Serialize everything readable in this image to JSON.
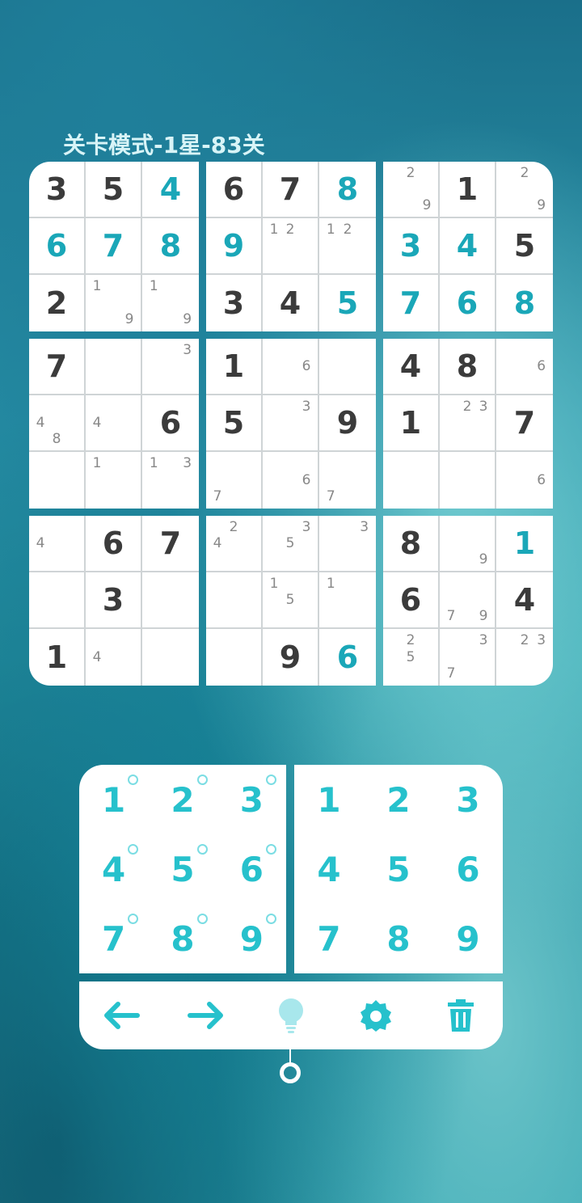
{
  "header": {
    "title": "关卡模式-1星-83关"
  },
  "colors": {
    "given": "#3b3b3b",
    "user": "#1aa7b8",
    "accent": "#26c1cc"
  },
  "board": {
    "rows": [
      [
        {
          "v": "3",
          "t": "given"
        },
        {
          "v": "5",
          "t": "given"
        },
        {
          "v": "4",
          "t": "user"
        },
        {
          "v": "6",
          "t": "given"
        },
        {
          "v": "7",
          "t": "given"
        },
        {
          "v": "8",
          "t": "user"
        },
        {
          "n": [
            "2",
            "9"
          ]
        },
        {
          "v": "1",
          "t": "given"
        },
        {
          "n": [
            "2",
            "9"
          ]
        }
      ],
      [
        {
          "v": "6",
          "t": "user"
        },
        {
          "v": "7",
          "t": "user"
        },
        {
          "v": "8",
          "t": "user"
        },
        {
          "v": "9",
          "t": "user"
        },
        {
          "n": [
            "1",
            "2"
          ]
        },
        {
          "n": [
            "1",
            "2"
          ]
        },
        {
          "v": "3",
          "t": "user"
        },
        {
          "v": "4",
          "t": "user"
        },
        {
          "v": "5",
          "t": "given"
        }
      ],
      [
        {
          "v": "2",
          "t": "given"
        },
        {
          "n": [
            "1",
            "9"
          ]
        },
        {
          "n": [
            "1",
            "9"
          ]
        },
        {
          "v": "3",
          "t": "given"
        },
        {
          "v": "4",
          "t": "given"
        },
        {
          "v": "5",
          "t": "user"
        },
        {
          "v": "7",
          "t": "user"
        },
        {
          "v": "6",
          "t": "user"
        },
        {
          "v": "8",
          "t": "user"
        }
      ],
      [
        {
          "v": "7",
          "t": "given"
        },
        {},
        {
          "n": [
            "3"
          ]
        },
        {
          "v": "1",
          "t": "given"
        },
        {
          "n": [
            "6"
          ]
        },
        {},
        {
          "v": "4",
          "t": "given"
        },
        {
          "v": "8",
          "t": "given"
        },
        {
          "n": [
            "6"
          ]
        }
      ],
      [
        {
          "n": [
            "4",
            "8"
          ]
        },
        {
          "n": [
            "4"
          ]
        },
        {
          "v": "6",
          "t": "given"
        },
        {
          "v": "5",
          "t": "given"
        },
        {
          "n": [
            "3"
          ]
        },
        {
          "v": "9",
          "t": "given"
        },
        {
          "v": "1",
          "t": "given"
        },
        {
          "n": [
            "2",
            "3"
          ]
        },
        {
          "v": "7",
          "t": "given"
        }
      ],
      [
        {},
        {
          "n": [
            "1"
          ]
        },
        {
          "n": [
            "1",
            "3"
          ]
        },
        {
          "n": [
            "7"
          ]
        },
        {
          "n": [
            "6"
          ]
        },
        {
          "n": [
            "7"
          ]
        },
        {},
        {},
        {
          "n": [
            "6"
          ]
        }
      ],
      [
        {
          "n": [
            "4"
          ]
        },
        {
          "v": "6",
          "t": "given"
        },
        {
          "v": "7",
          "t": "given"
        },
        {
          "n": [
            "2",
            "4"
          ]
        },
        {
          "n": [
            "3",
            "5"
          ]
        },
        {
          "n": [
            "3"
          ]
        },
        {
          "v": "8",
          "t": "given"
        },
        {
          "n": [
            "9"
          ]
        },
        {
          "v": "1",
          "t": "user"
        }
      ],
      [
        {},
        {
          "v": "3",
          "t": "given"
        },
        {},
        {},
        {
          "n": [
            "1",
            "5"
          ]
        },
        {
          "n": [
            "1"
          ]
        },
        {
          "v": "6",
          "t": "given"
        },
        {
          "n": [
            "7",
            "9"
          ]
        },
        {
          "v": "4",
          "t": "given"
        }
      ],
      [
        {
          "v": "1",
          "t": "given"
        },
        {
          "n": [
            "4"
          ]
        },
        {},
        {},
        {
          "v": "9",
          "t": "given"
        },
        {
          "v": "6",
          "t": "user"
        },
        {
          "n": [
            "2",
            "5"
          ]
        },
        {
          "n": [
            "3",
            "7"
          ]
        },
        {
          "n": [
            "2",
            "3"
          ]
        }
      ]
    ]
  },
  "note_keys": [
    "1",
    "2",
    "3",
    "4",
    "5",
    "6",
    "7",
    "8",
    "9"
  ],
  "number_keys": [
    "1",
    "2",
    "3",
    "4",
    "5",
    "6",
    "7",
    "8",
    "9"
  ],
  "toolbar": {
    "icons": [
      "undo-arrow-icon",
      "redo-arrow-icon",
      "hint-lightbulb-icon",
      "settings-gear-icon",
      "delete-trash-icon"
    ]
  }
}
